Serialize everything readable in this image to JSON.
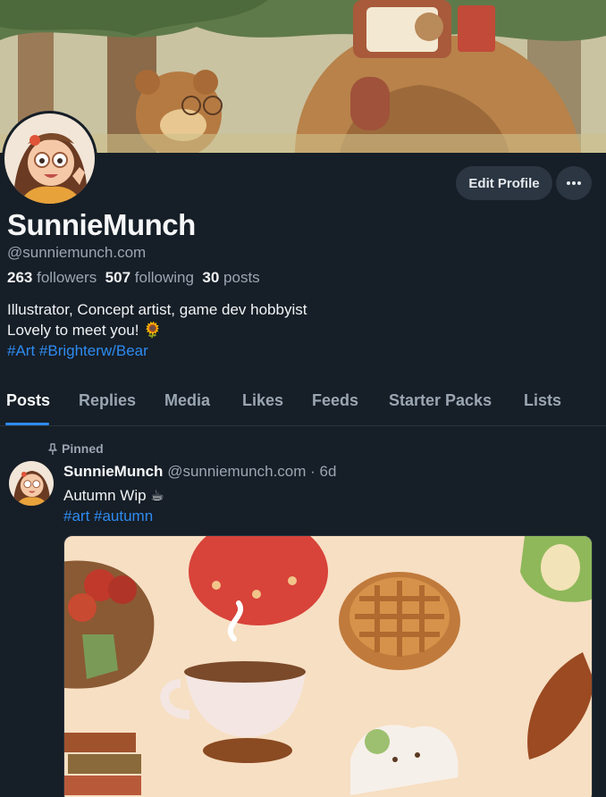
{
  "profile": {
    "display_name": "SunnieMunch",
    "handle": "@sunniemunch.com",
    "followers_count": "263",
    "followers_label": "followers",
    "following_count": "507",
    "following_label": "following",
    "posts_count": "30",
    "posts_label": "posts",
    "bio_line1": "Illustrator, Concept artist, game dev hobbyist",
    "bio_line2": "Lovely to meet you!",
    "bio_emoji": "🌻",
    "bio_tags": "#Art #Brighterw/Bear"
  },
  "actions": {
    "edit_profile": "Edit Profile",
    "more_icon": "more-horizontal-icon"
  },
  "tabs": [
    {
      "label": "Posts",
      "active": true
    },
    {
      "label": "Replies"
    },
    {
      "label": "Media"
    },
    {
      "label": "Likes"
    },
    {
      "label": "Feeds"
    },
    {
      "label": "Starter Packs"
    },
    {
      "label": "Lists"
    }
  ],
  "post": {
    "pinned_label": "Pinned",
    "author_name": "SunnieMunch",
    "author_handle": "@sunniemunch.com",
    "separator": "·",
    "time": "6d",
    "text": "Autumn Wip",
    "text_emoji": "☕",
    "tags": "#art #autumn"
  },
  "colors": {
    "background": "#161e27",
    "accent": "#2e8bf0",
    "muted": "#9aa6b2",
    "button_bg": "#2b3642"
  }
}
